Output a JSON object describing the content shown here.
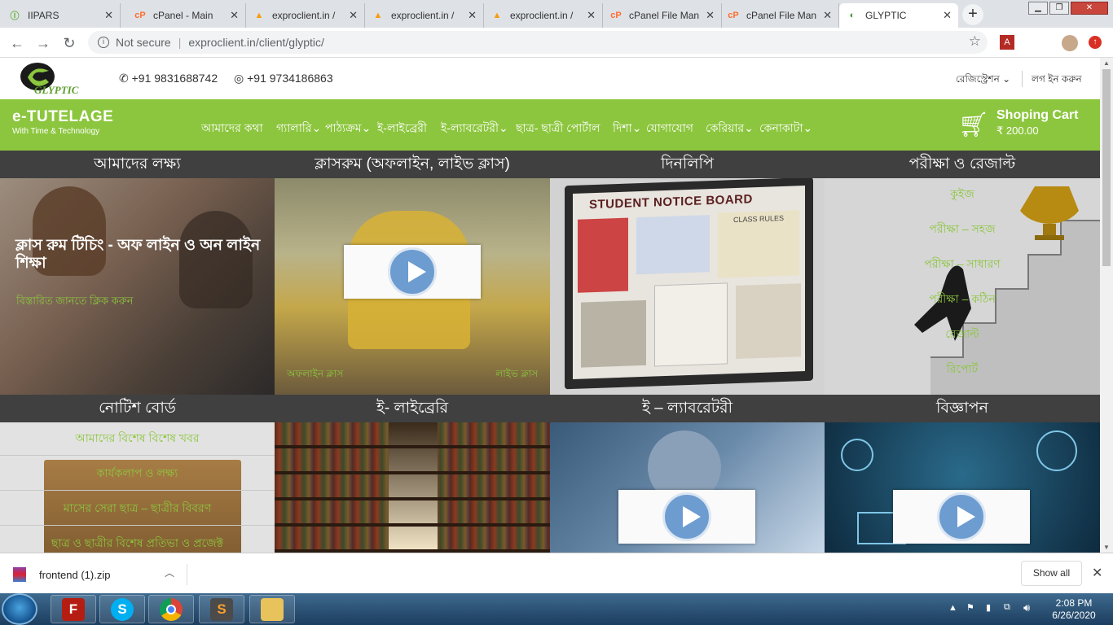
{
  "browser": {
    "tabs": [
      {
        "icon": "iipars-icon",
        "label": "IIPARS"
      },
      {
        "icon": "cpanel-icon",
        "label": "cPanel - Main"
      },
      {
        "icon": "pma-icon",
        "label": "exproclient.in /"
      },
      {
        "icon": "pma-icon",
        "label": "exproclient.in /"
      },
      {
        "icon": "pma-icon",
        "label": "exproclient.in /"
      },
      {
        "icon": "cpanel-icon",
        "label": "cPanel File Man"
      },
      {
        "icon": "cpanel-icon",
        "label": "cPanel File Man"
      },
      {
        "icon": "glyptic-icon",
        "label": "GLYPTIC",
        "active": true
      }
    ],
    "security_label": "Not secure",
    "url": "exproclient.in/client/glyptic/"
  },
  "site": {
    "logo_text": "GLYPTIC",
    "phone": "+91 9831688742",
    "whatsapp": "+91 9734186863",
    "registration": "রেজিস্ট্রেশন",
    "login": "লগ ইন করুন",
    "brand_title": "e-TUTELAGE",
    "brand_tagline": "With Time & Technology",
    "menu": [
      "আমাদের কথা",
      "গ্যালারি",
      "পাঠ্যক্রম",
      "ই-লাইব্রেরী",
      "ই-ল্যাবরেটরী",
      "ছাত্র- ছাত্রী পোর্টাল",
      "দিশা",
      "যোগাযোগ",
      "কেরিয়ার",
      "কেনাকাটা"
    ],
    "cart_title": "Shoping Cart",
    "cart_amount": "₹ 200.00"
  },
  "tiles": {
    "goal": {
      "title": "আমাদের লক্ষ্য",
      "headline": "ক্লাস রুম টিচিং - অফ লাইন ও অন লাইন শিক্ষা",
      "link": "বিস্তারিত জানতে ক্লিক করুন"
    },
    "classroom": {
      "title": "ক্লাসরুম (অফলাইন, লাইভ ক্লাস)",
      "offline": "অফলাইন ক্লাস",
      "live": "লাইভ ক্লাস"
    },
    "diary": {
      "title": "দিনলিপি",
      "board_text": "STUDENT NOTICE BOARD",
      "rules_text": "CLASS RULES"
    },
    "exam": {
      "title": "পরীক্ষা ও রেজাল্ট",
      "items": [
        "কুইজ",
        "পরীক্ষা – সহজ",
        "পরীক্ষা – সাধারণ",
        "পরীক্ষা – কঠিন",
        "রেজাল্ট",
        "রিপোর্ট"
      ]
    },
    "notice": {
      "title": "নোটিশ বোর্ড",
      "items": [
        "আমাদের বিশেষ বিশেষ খবর",
        "কার্যকলাপ ও লক্ষ্য",
        "মাসের সেরা ছাত্র – ছাত্রীর বিবরণ",
        "ছাত্র ও ছাত্রীর বিশেষ প্রতিভা ও প্রজেক্ট"
      ]
    },
    "library": {
      "title": "ই- লাইব্রেরি"
    },
    "lab": {
      "title": "ই – ল্যাবরেটরী"
    },
    "ads": {
      "title": "বিজ্ঞাপন"
    }
  },
  "download": {
    "filename": "frontend (1).zip",
    "show_all": "Show all"
  },
  "taskbar": {
    "time": "2:08 PM",
    "date": "6/26/2020"
  },
  "colors": {
    "brand_green": "#8cc63e",
    "tile_header": "#404040"
  }
}
